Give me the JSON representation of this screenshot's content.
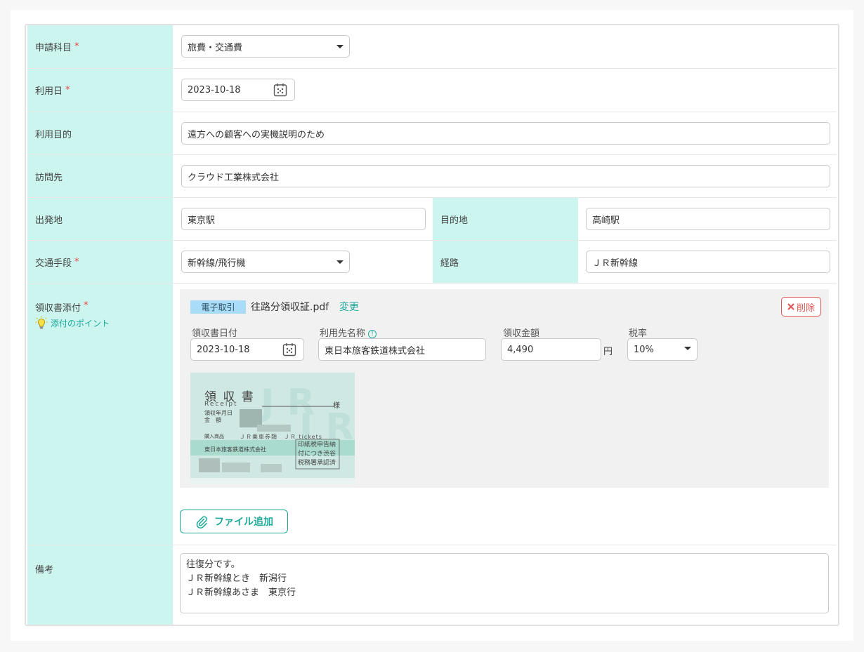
{
  "fields": {
    "category": {
      "label": "申請科目",
      "required": "*",
      "value": "旅費・交通費"
    },
    "use_date": {
      "label": "利用日",
      "required": "*",
      "value": "2023-10-18"
    },
    "purpose": {
      "label": "利用目的",
      "value": "遠方への顧客への実機説明のため"
    },
    "visit": {
      "label": "訪問先",
      "value": "クラウド工業株式会社"
    },
    "departure": {
      "label": "出発地",
      "value": "東京駅"
    },
    "destination": {
      "label": "目的地",
      "value": "高崎駅"
    },
    "transport": {
      "label": "交通手段",
      "required": "*",
      "value": "新幹線/飛行機"
    },
    "route": {
      "label": "経路",
      "value": "ＪＲ新幹線"
    },
    "receipt": {
      "label": "領収書添付",
      "required": "*",
      "hint": "添付のポイント"
    },
    "remarks": {
      "label": "備考",
      "value": "往復分です。\nＪＲ新幹線とき　新潟行\nＪＲ新幹線あさま　東京行"
    }
  },
  "attachment": {
    "tag": "電子取引",
    "filename": "往路分領収証.pdf",
    "change_label": "変更",
    "delete_label": "削除",
    "receipt_date": {
      "label": "領収書日付",
      "value": "2023-10-18"
    },
    "payee": {
      "label": "利用先名称",
      "value": "東日本旅客鉄道株式会社"
    },
    "amount": {
      "label": "領収金額",
      "value": "4,490",
      "unit": "円"
    },
    "tax": {
      "label": "税率",
      "value": "10%"
    }
  },
  "receipt_image": {
    "title": "領 収 書",
    "receipt_word": "Receipt",
    "honorific": "様",
    "date_label": "領収年月日",
    "amount_label": "金　額",
    "item_label": "購入商品",
    "item_value": "ＪＲ乗車券類　ＪＲ tickets",
    "issuer": "東日本旅客鉄道株式会社",
    "stamp_lines": [
      "印紙税申告納",
      "付につき渋谷",
      "税務署承認済"
    ]
  },
  "add_file_label": "ファイル追加",
  "colors": {
    "label_bg": "#ccf5f0",
    "accent": "#1ca99a",
    "required": "#e04646",
    "tag_bg": "#a9dcf7"
  }
}
